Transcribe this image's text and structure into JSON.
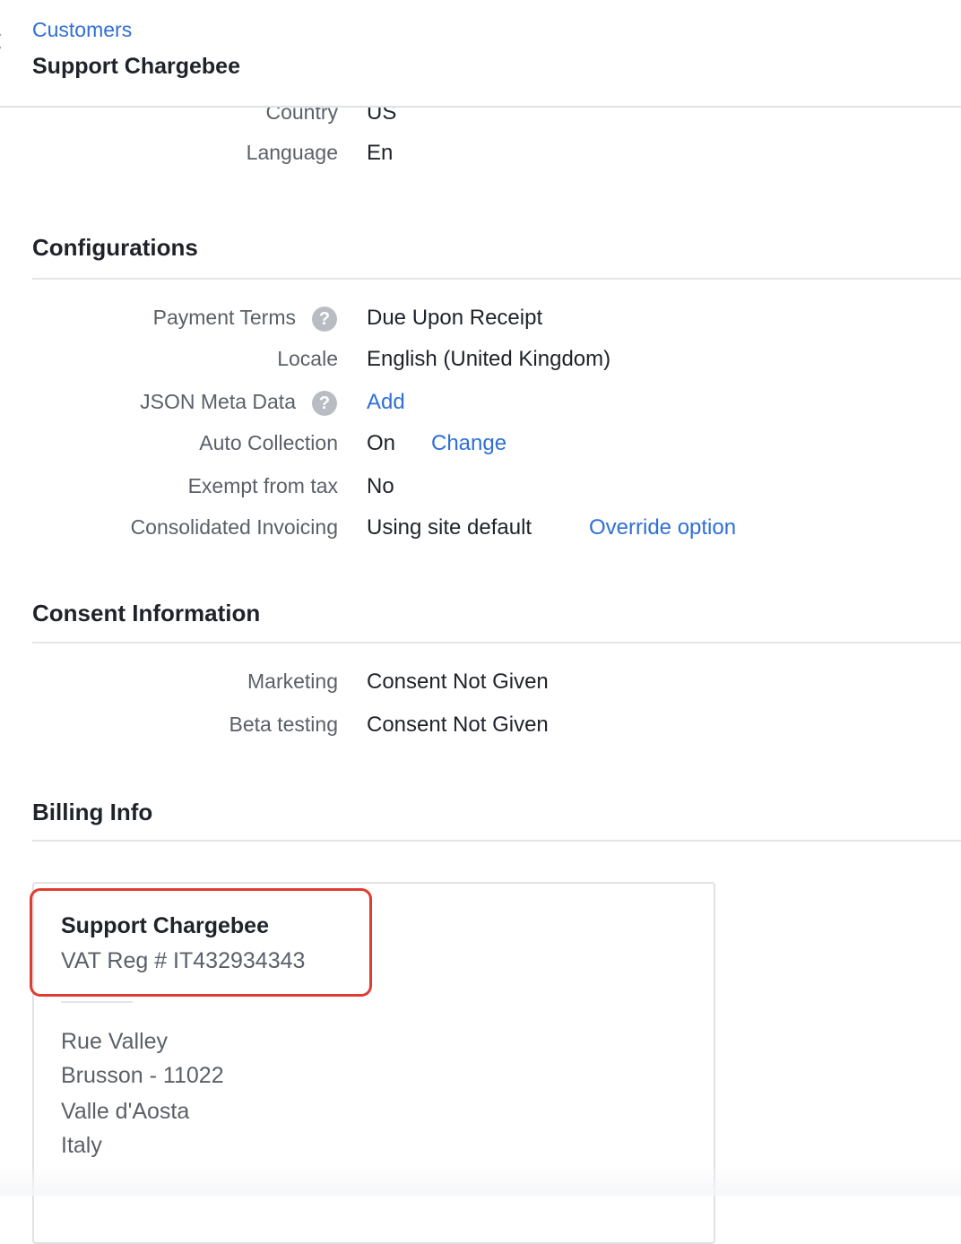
{
  "header": {
    "breadcrumb": "Customers",
    "title": "Support Chargebee"
  },
  "details": [
    {
      "label": "Country",
      "value": "US"
    },
    {
      "label": "Language",
      "value": "En"
    }
  ],
  "configurations": {
    "title": "Configurations",
    "payment_terms": {
      "label": "Payment Terms",
      "value": "Due Upon Receipt"
    },
    "locale": {
      "label": "Locale",
      "value": "English (United Kingdom)"
    },
    "json_meta": {
      "label": "JSON Meta Data",
      "action": "Add"
    },
    "auto_collection": {
      "label": "Auto Collection",
      "value": "On",
      "action": "Change"
    },
    "exempt_tax": {
      "label": "Exempt from tax",
      "value": "No"
    },
    "consolidated": {
      "label": "Consolidated Invoicing",
      "value": "Using site default",
      "action": "Override option"
    }
  },
  "consent": {
    "title": "Consent Information",
    "items": [
      {
        "label": "Marketing",
        "value": "Consent Not Given"
      },
      {
        "label": "Beta testing",
        "value": "Consent Not Given"
      }
    ]
  },
  "billing": {
    "title": "Billing Info",
    "name": "Support Chargebee",
    "vat": "VAT Reg # IT432934343",
    "address": [
      "Rue Valley",
      "Brusson - 11022",
      "Valle d'Aosta",
      "Italy"
    ]
  },
  "colors": {
    "link": "#2f6fd6",
    "highlight": "#e03c31"
  },
  "icons": {
    "help": "question-circle-icon",
    "back": "chevron-left-icon"
  }
}
